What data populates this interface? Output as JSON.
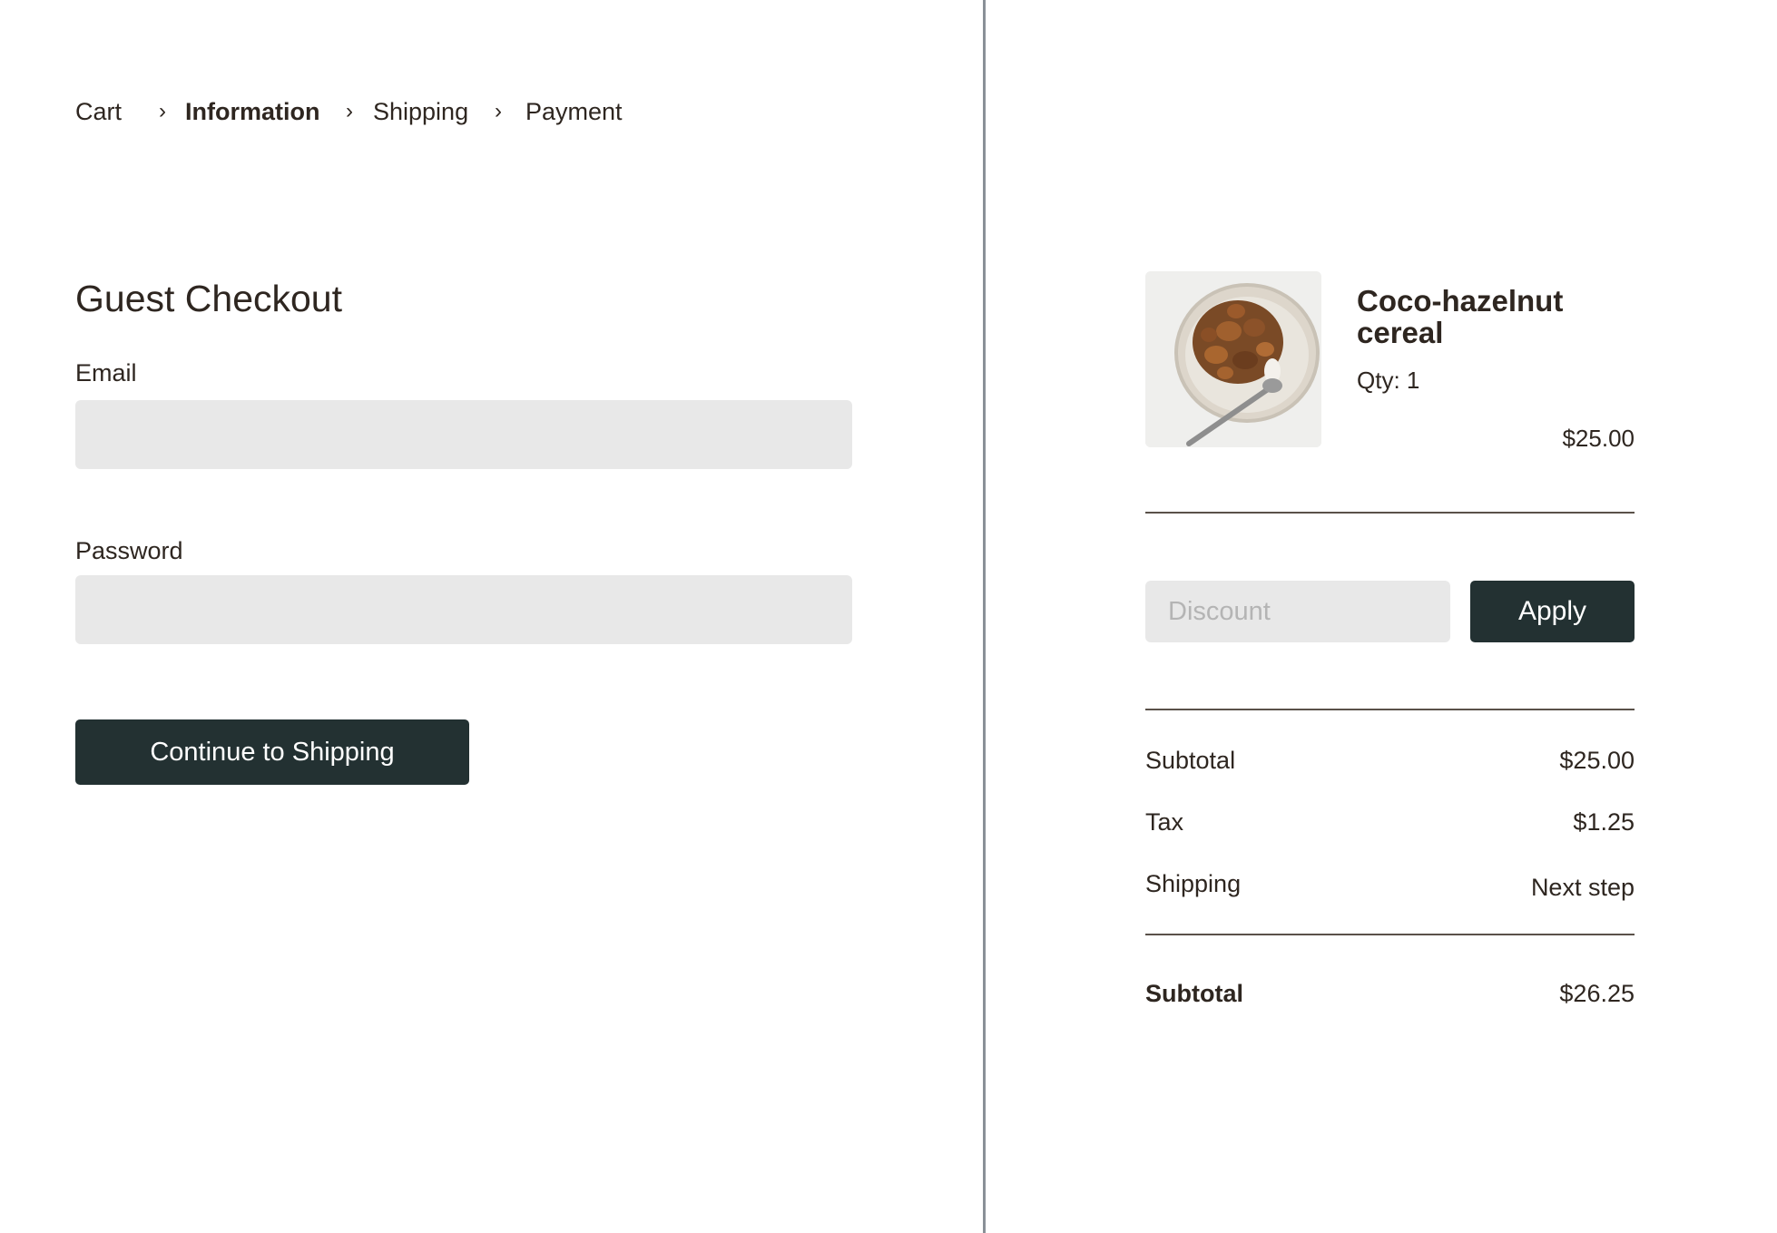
{
  "breadcrumb": {
    "steps": [
      "Cart",
      "Information",
      "Shipping",
      "Payment"
    ],
    "active": "Information",
    "separator": "›"
  },
  "form": {
    "title": "Guest Checkout",
    "email_label": "Email",
    "email_value": "",
    "password_label": "Password",
    "password_value": "",
    "continue_label": "Continue to Shipping"
  },
  "product": {
    "name": "Coco-hazelnut cereal",
    "qty": "Qty: 1",
    "price": "$25.00",
    "image_icon": "cereal-bowl-image"
  },
  "discount": {
    "placeholder": "Discount",
    "value": "",
    "apply_label": "Apply"
  },
  "summary": {
    "subtotal_label": "Subtotal",
    "subtotal_value": "$25.00",
    "tax_label": "Tax",
    "tax_value": "$1.25",
    "shipping_label": "Shipping",
    "shipping_value": "Next step",
    "total_label": "Subtotal",
    "total_value": "$26.25"
  },
  "colors": {
    "text": "#2e2620",
    "button_bg": "#233132",
    "button_text": "#ffffff",
    "input_bg": "#e8e8e8",
    "divider": "#8a9097"
  }
}
